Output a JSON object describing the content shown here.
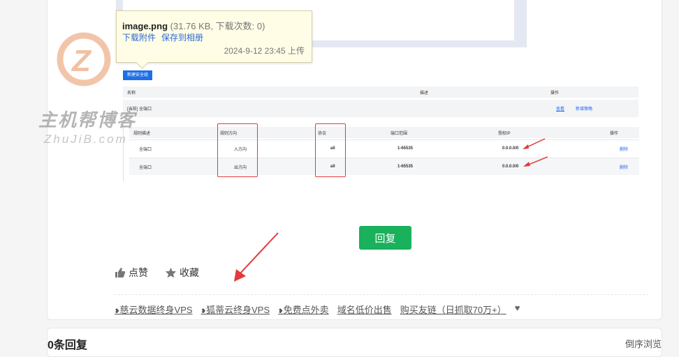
{
  "tooltip": {
    "filename": "image.png",
    "meta": "(31.76 KB, 下载次数: 0)",
    "download": "下载附件",
    "save": "保存到相册",
    "uploaded": "2024-9-12 23:45 上传"
  },
  "watermark": {
    "name": "主机帮博客",
    "url": "ZhuJiB.com"
  },
  "screenshot": {
    "new_button": "新建安全组",
    "header": {
      "name": "名称",
      "desc": "描述",
      "ops": "操作"
    },
    "group_row": {
      "name": "[当前] 全端口",
      "view": "查看",
      "add_rule": "新增策略"
    },
    "rule_header": {
      "desc": "规则描述",
      "direction": "规则方向",
      "protocol": "协议",
      "port": "端口范围",
      "ip": "授权IP",
      "ops": "操作"
    },
    "rules": [
      {
        "desc": "全端口",
        "direction": "入方向",
        "protocol": "all",
        "port": "1-65535",
        "ip": "0.0.0.0/0",
        "op": "删除"
      },
      {
        "desc": "全端口",
        "direction": "出方向",
        "protocol": "all",
        "port": "1-65535",
        "ip": "0.0.0.0/0",
        "op": "删除"
      }
    ]
  },
  "reply_label": "回复",
  "actions": {
    "like": "点赞",
    "fav": "收藏"
  },
  "footer_links": [
    "慈云数据终身VPS",
    "狐蒂云终身VPS",
    "免费点外卖",
    "域名低价出售",
    "购买友链（日抓取70万+）"
  ],
  "next_section": {
    "left": "0条回复",
    "right": "倒序浏览"
  },
  "colors": {
    "accent_green": "#19b15c",
    "link_blue": "#2b6bd6",
    "annotation_red": "#e23b3b"
  }
}
